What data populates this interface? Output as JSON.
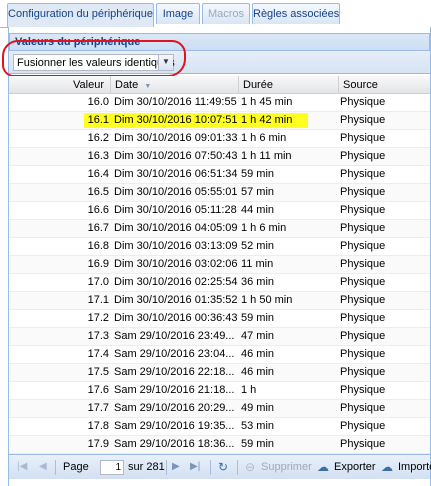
{
  "tabs": [
    {
      "label": "Configuration du périphérique",
      "state": "active"
    },
    {
      "label": "Image",
      "state": "normal"
    },
    {
      "label": "Macros",
      "state": "disabled"
    },
    {
      "label": "Règles associées",
      "state": "normal"
    }
  ],
  "panel": {
    "title": "Valeurs du périphérique"
  },
  "filter": {
    "selected": "Fusionner les valeurs identiques"
  },
  "columns": {
    "value": "Valeur",
    "date": "Date",
    "date_sort_icon": "sort-desc-icon",
    "duration": "Durée",
    "source": "Source"
  },
  "rows": [
    {
      "value": "16.0",
      "date": "Dim 30/10/2016 11:49:55",
      "duration": "1 h 45 min",
      "source": "Physique",
      "highlighted": false
    },
    {
      "value": "16.1",
      "date": "Dim 30/10/2016 10:07:51",
      "duration": "1 h 42 min",
      "source": "Physique",
      "highlighted": true
    },
    {
      "value": "16.2",
      "date": "Dim 30/10/2016 09:01:33",
      "duration": "1 h 6 min",
      "source": "Physique",
      "highlighted": false
    },
    {
      "value": "16.3",
      "date": "Dim 30/10/2016 07:50:43",
      "duration": "1 h 11 min",
      "source": "Physique",
      "highlighted": false
    },
    {
      "value": "16.4",
      "date": "Dim 30/10/2016 06:51:34",
      "duration": "59 min",
      "source": "Physique",
      "highlighted": false
    },
    {
      "value": "16.5",
      "date": "Dim 30/10/2016 05:55:01",
      "duration": "57 min",
      "source": "Physique",
      "highlighted": false
    },
    {
      "value": "16.6",
      "date": "Dim 30/10/2016 05:11:28",
      "duration": "44 min",
      "source": "Physique",
      "highlighted": false
    },
    {
      "value": "16.7",
      "date": "Dim 30/10/2016 04:05:09",
      "duration": "1 h 6 min",
      "source": "Physique",
      "highlighted": false
    },
    {
      "value": "16.8",
      "date": "Dim 30/10/2016 03:13:09",
      "duration": "52 min",
      "source": "Physique",
      "highlighted": false
    },
    {
      "value": "16.9",
      "date": "Dim 30/10/2016 03:02:06",
      "duration": "11 min",
      "source": "Physique",
      "highlighted": false
    },
    {
      "value": "17.0",
      "date": "Dim 30/10/2016 02:25:54",
      "duration": "36 min",
      "source": "Physique",
      "highlighted": false
    },
    {
      "value": "17.1",
      "date": "Dim 30/10/2016 01:35:52",
      "duration": "1 h 50 min",
      "source": "Physique",
      "highlighted": false
    },
    {
      "value": "17.2",
      "date": "Dim 30/10/2016 00:36:43",
      "duration": "59 min",
      "source": "Physique",
      "highlighted": false
    },
    {
      "value": "17.3",
      "date": "Sam 29/10/2016 23:49...",
      "duration": "47 min",
      "source": "Physique",
      "highlighted": false
    },
    {
      "value": "17.4",
      "date": "Sam 29/10/2016 23:04...",
      "duration": "46 min",
      "source": "Physique",
      "highlighted": false
    },
    {
      "value": "17.5",
      "date": "Sam 29/10/2016 22:18...",
      "duration": "46 min",
      "source": "Physique",
      "highlighted": false
    },
    {
      "value": "17.6",
      "date": "Sam 29/10/2016 21:18...",
      "duration": "1 h",
      "source": "Physique",
      "highlighted": false
    },
    {
      "value": "17.7",
      "date": "Sam 29/10/2016 20:29...",
      "duration": "49 min",
      "source": "Physique",
      "highlighted": false
    },
    {
      "value": "17.8",
      "date": "Sam 29/10/2016 19:35...",
      "duration": "53 min",
      "source": "Physique",
      "highlighted": false
    },
    {
      "value": "17.9",
      "date": "Sam 29/10/2016 18:36...",
      "duration": "59 min",
      "source": "Physique",
      "highlighted": false
    }
  ],
  "pager": {
    "page_label": "Page",
    "current_page": "1",
    "of_label": "sur 281",
    "delete_label": "Supprimer",
    "export_label": "Exporter",
    "import_label": "Importer"
  },
  "colors": {
    "highlight": "#ffff22",
    "annotation": "#e0141e",
    "accent": "#15428b"
  }
}
